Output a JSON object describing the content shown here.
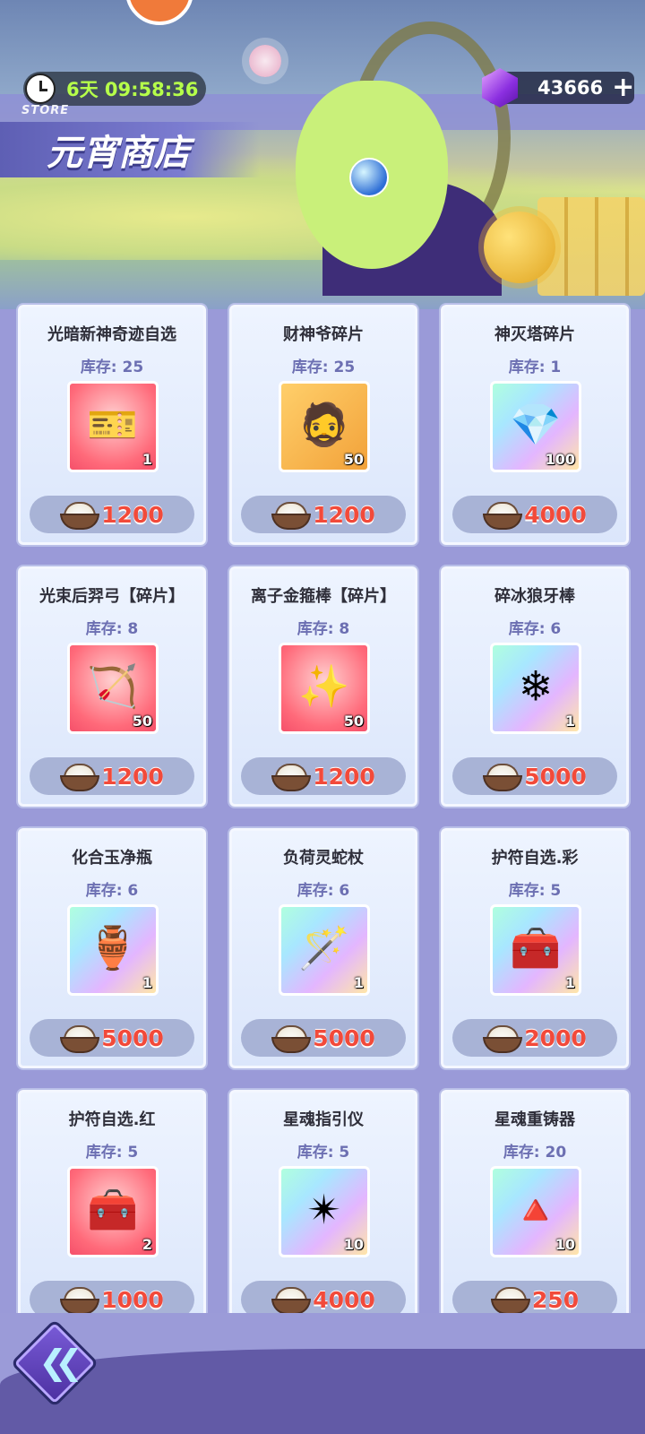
{
  "header": {
    "timer": "6天 09:58:36",
    "store_label": "STORE",
    "title": "元宵商店",
    "currency_amount": "43666",
    "plus_label": "+"
  },
  "items": [
    {
      "name": "光暗新神奇迹自选",
      "stock": "库存: 25",
      "count": "1",
      "price": "1200",
      "icon": "ticket-icon",
      "bg": "red",
      "symbol": "🎫"
    },
    {
      "name": "财神爷碎片",
      "stock": "库存: 25",
      "count": "50",
      "price": "1200",
      "icon": "god-of-wealth-portrait-icon",
      "bg": "gold",
      "symbol": "🧔"
    },
    {
      "name": "神灭塔碎片",
      "stock": "库存: 1",
      "count": "100",
      "price": "4000",
      "icon": "red-crystal-icon",
      "bg": "rainbow",
      "symbol": "💎"
    },
    {
      "name": "光束后羿弓【碎片】",
      "stock": "库存: 8",
      "count": "50",
      "price": "1200",
      "icon": "flame-bow-icon",
      "bg": "red",
      "symbol": "🏹"
    },
    {
      "name": "离子金箍棒【碎片】",
      "stock": "库存: 8",
      "count": "50",
      "price": "1200",
      "icon": "golden-staff-icon",
      "bg": "red",
      "symbol": "✨"
    },
    {
      "name": "碎冰狼牙棒",
      "stock": "库存: 6",
      "count": "1",
      "price": "5000",
      "icon": "ice-mace-icon",
      "bg": "rainbow",
      "symbol": "❄"
    },
    {
      "name": "化合玉净瓶",
      "stock": "库存: 6",
      "count": "1",
      "price": "5000",
      "icon": "jade-vase-icon",
      "bg": "rainbow",
      "symbol": "🏺"
    },
    {
      "name": "负荷灵蛇杖",
      "stock": "库存: 6",
      "count": "1",
      "price": "5000",
      "icon": "serpent-staff-icon",
      "bg": "rainbow",
      "symbol": "🪄"
    },
    {
      "name": "护符自选.彩",
      "stock": "库存: 5",
      "count": "1",
      "price": "2000",
      "icon": "rainbow-chest-icon",
      "bg": "rainbow",
      "symbol": "🧰"
    },
    {
      "name": "护符自选.红",
      "stock": "库存: 5",
      "count": "2",
      "price": "1000",
      "icon": "red-chest-icon",
      "bg": "red",
      "symbol": "🧰"
    },
    {
      "name": "星魂指引仪",
      "stock": "库存: 5",
      "count": "10",
      "price": "4000",
      "icon": "star-compass-icon",
      "bg": "rainbow",
      "symbol": "✴"
    },
    {
      "name": "星魂重铸器",
      "stock": "库存: 20",
      "count": "10",
      "price": "250",
      "icon": "triangle-forge-icon",
      "bg": "rainbow",
      "symbol": "🔺"
    }
  ],
  "colors": {
    "price": "#f24a3a",
    "timer": "#b6ff4a",
    "stock": "#6c6fb2"
  }
}
